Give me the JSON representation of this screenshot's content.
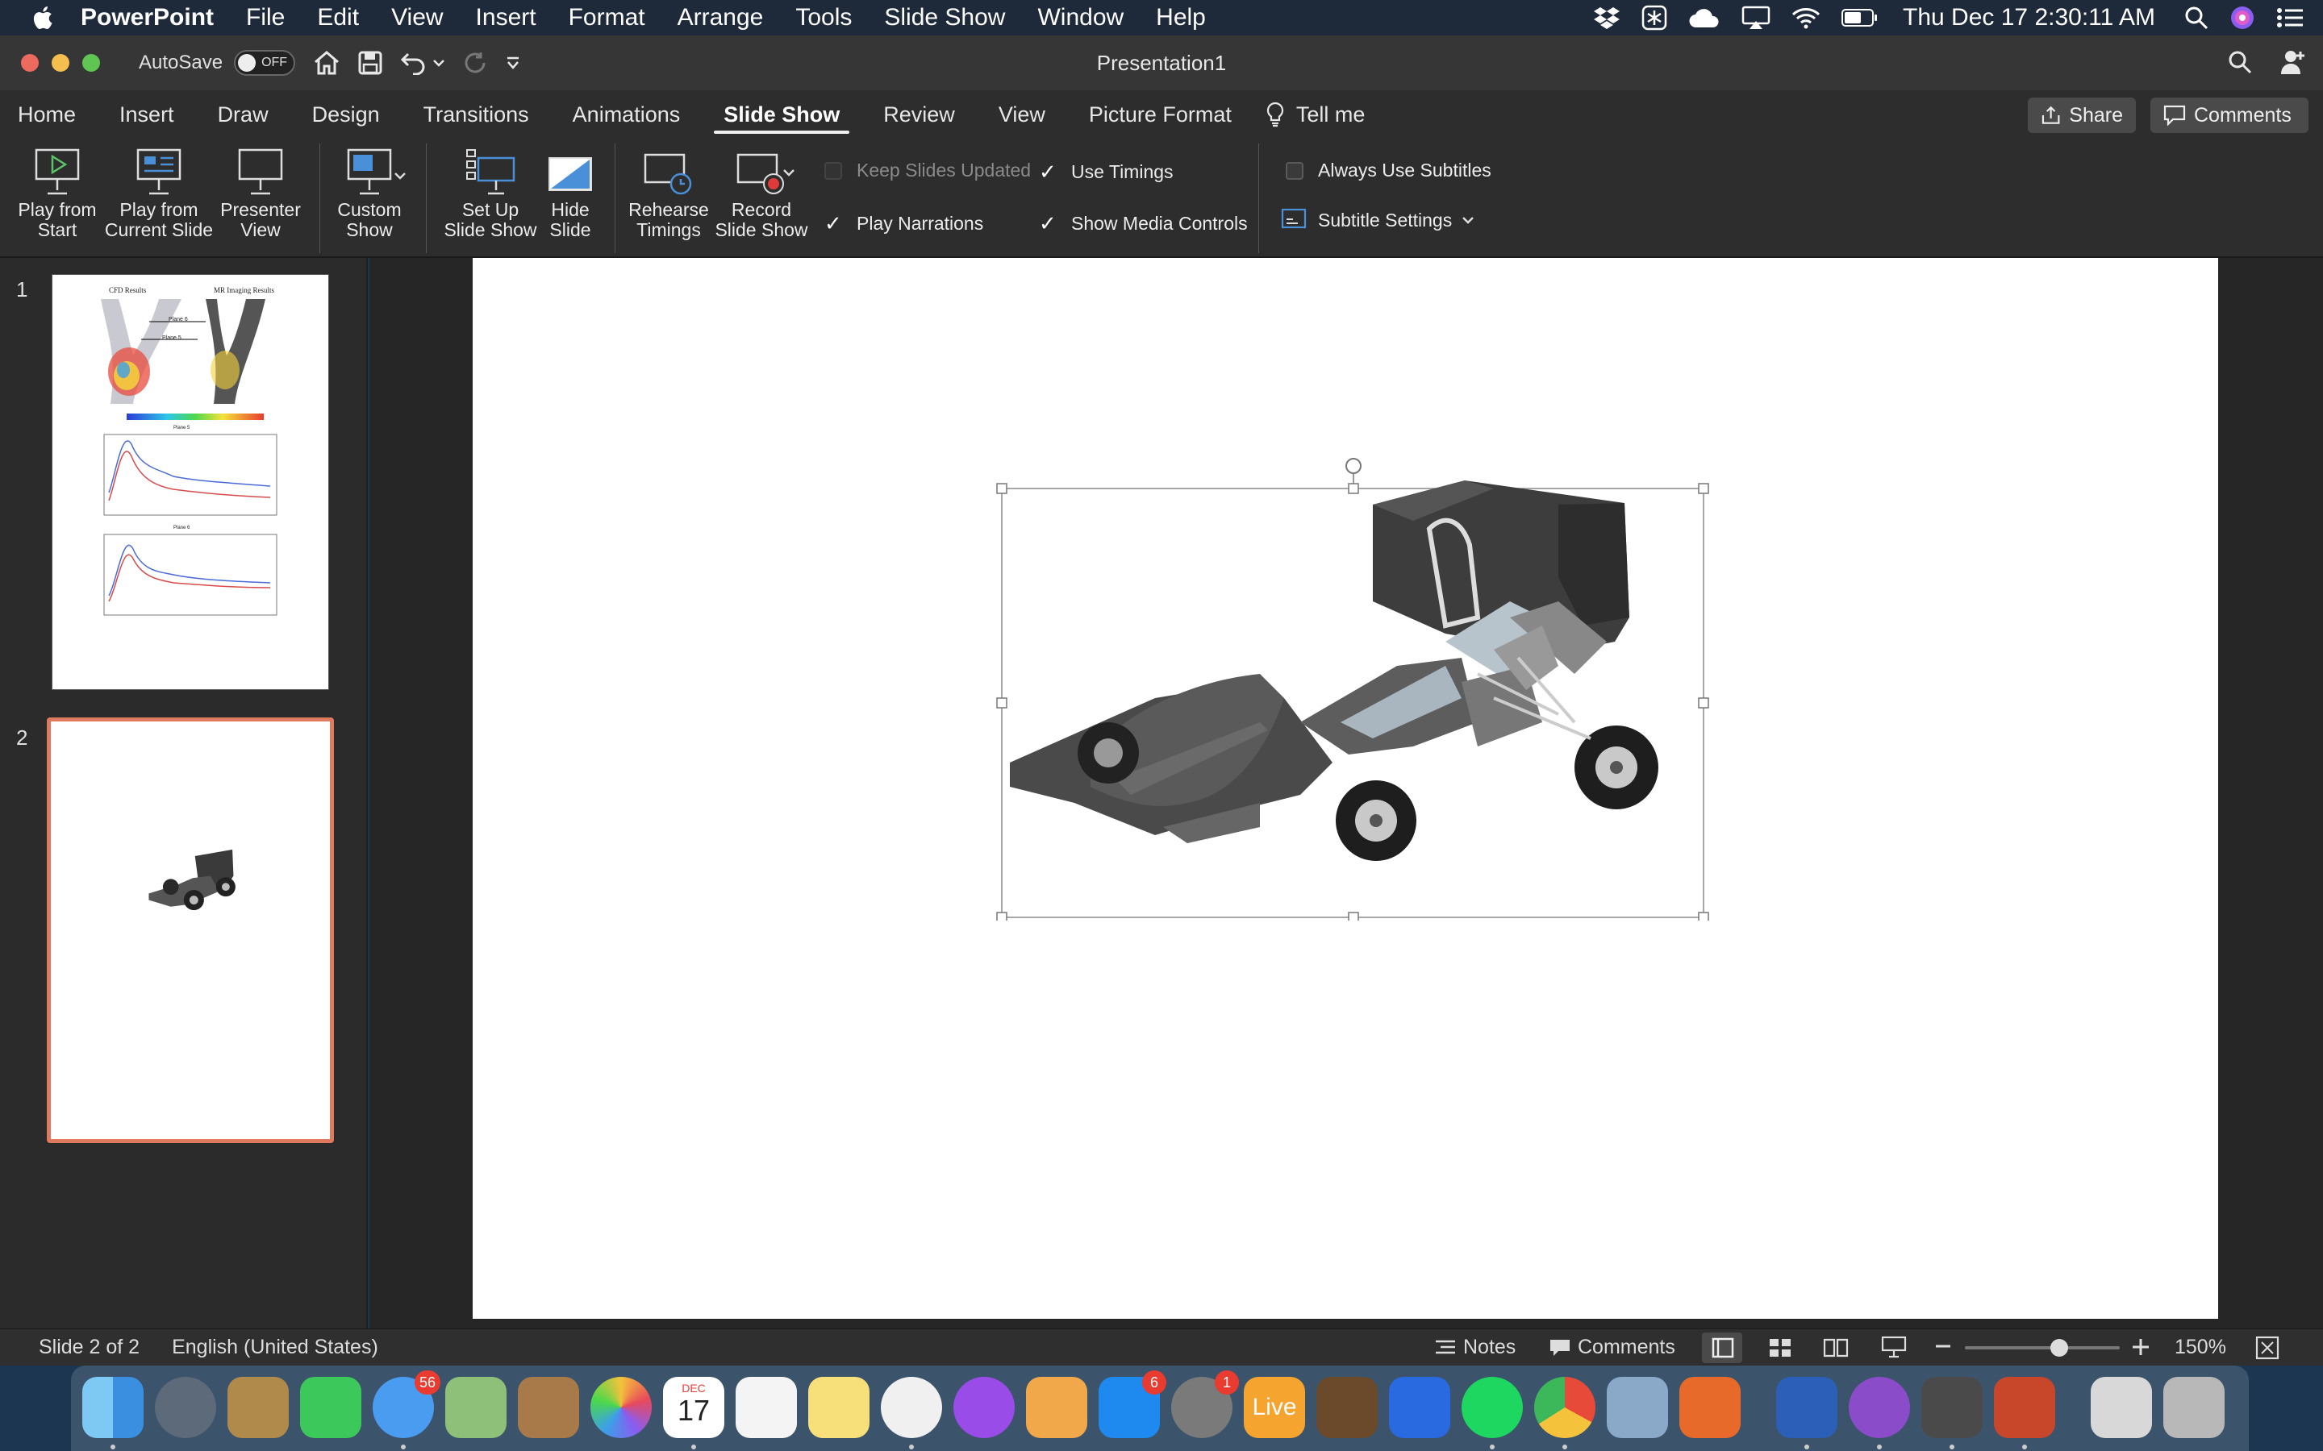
{
  "menubar": {
    "app_name": "PowerPoint",
    "items": [
      "File",
      "Edit",
      "View",
      "Insert",
      "Format",
      "Arrange",
      "Tools",
      "Slide Show",
      "Window",
      "Help"
    ],
    "clock": "Thu Dec 17  2:30:11 AM"
  },
  "titlebar": {
    "autosave_label": "AutoSave",
    "autosave_state": "OFF",
    "document_title": "Presentation1"
  },
  "tabs": {
    "items": [
      "Home",
      "Insert",
      "Draw",
      "Design",
      "Transitions",
      "Animations",
      "Slide Show",
      "Review",
      "View",
      "Picture Format"
    ],
    "active": "Slide Show",
    "tell_me": "Tell me",
    "share_label": "Share",
    "comments_label": "Comments"
  },
  "ribbon": {
    "play_from_start": [
      "Play from",
      "Start"
    ],
    "play_from_current": [
      "Play from",
      "Current Slide"
    ],
    "presenter_view": [
      "Presenter",
      "View"
    ],
    "custom_show": [
      "Custom",
      "Show"
    ],
    "set_up": [
      "Set Up",
      "Slide Show"
    ],
    "hide_slide": [
      "Hide",
      "Slide"
    ],
    "rehearse": [
      "Rehearse",
      "Timings"
    ],
    "record": [
      "Record",
      "Slide Show"
    ],
    "keep_updated": {
      "label": "Keep Slides Updated",
      "checked": false,
      "enabled": false
    },
    "play_narrations": {
      "label": "Play Narrations",
      "checked": true
    },
    "use_timings": {
      "label": "Use Timings",
      "checked": true
    },
    "show_media_controls": {
      "label": "Show Media Controls",
      "checked": true
    },
    "always_subtitles": {
      "label": "Always Use Subtitles",
      "checked": false
    },
    "subtitle_settings": "Subtitle Settings"
  },
  "slides": {
    "numbers": [
      "1",
      "2"
    ],
    "selected": 2,
    "slide1_titles": [
      "CFD Results",
      "MR Imaging Results"
    ],
    "slide1_labels": [
      "Plane 6",
      "Plane 5",
      "Plane 5",
      "Plane 6"
    ]
  },
  "statusbar": {
    "slide_info": "Slide 2 of 2",
    "language": "English (United States)",
    "notes_label": "Notes",
    "comments_label": "Comments",
    "zoom": "150%",
    "zoom_level_percent": 150
  },
  "dock": {
    "badges": {
      "messages": "56",
      "app_store": "6",
      "system_preferences": "1",
      "calendar_month": "DEC",
      "calendar_day": "17",
      "live": "Live"
    }
  },
  "colors": {
    "accent_selected_slide": "#e07a5f",
    "menubar_bg": "#1e2a3a",
    "ribbon_bg": "#2d2d2d"
  }
}
